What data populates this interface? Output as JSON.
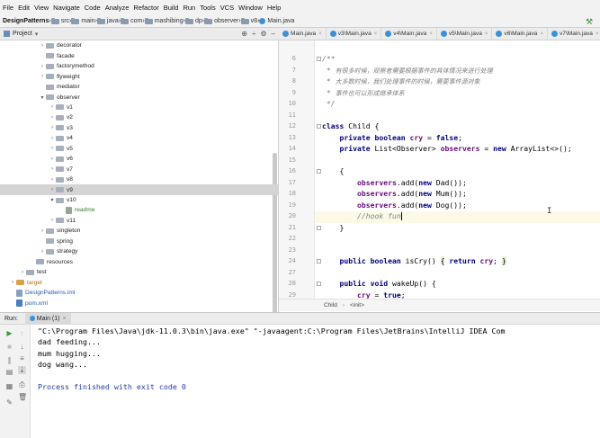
{
  "menu": [
    "File",
    "Edit",
    "View",
    "Navigate",
    "Code",
    "Analyze",
    "Refactor",
    "Build",
    "Run",
    "Tools",
    "VCS",
    "Window",
    "Help"
  ],
  "breadcrumb": [
    "DesignPatterns",
    "src",
    "main",
    "java",
    "com",
    "mashibing",
    "dp",
    "observer",
    "v8",
    "Main.java"
  ],
  "project": {
    "title": "Project",
    "tree": [
      {
        "label": "decorator",
        "depth": 3,
        "arrow": "right",
        "type": "pkg"
      },
      {
        "label": "facade",
        "depth": 3,
        "arrow": "",
        "type": "pkg"
      },
      {
        "label": "factorymethod",
        "depth": 3,
        "arrow": "right",
        "type": "pkg"
      },
      {
        "label": "flyweight",
        "depth": 3,
        "arrow": "right",
        "type": "pkg"
      },
      {
        "label": "mediator",
        "depth": 3,
        "arrow": "",
        "type": "pkg"
      },
      {
        "label": "observer",
        "depth": 3,
        "arrow": "down",
        "type": "pkg"
      },
      {
        "label": "v1",
        "depth": 4,
        "arrow": "right",
        "type": "pkg"
      },
      {
        "label": "v2",
        "depth": 4,
        "arrow": "right",
        "type": "pkg"
      },
      {
        "label": "v3",
        "depth": 4,
        "arrow": "right",
        "type": "pkg"
      },
      {
        "label": "v4",
        "depth": 4,
        "arrow": "right",
        "type": "pkg"
      },
      {
        "label": "v5",
        "depth": 4,
        "arrow": "right",
        "type": "pkg"
      },
      {
        "label": "v6",
        "depth": 4,
        "arrow": "right",
        "type": "pkg"
      },
      {
        "label": "v7",
        "depth": 4,
        "arrow": "right",
        "type": "pkg"
      },
      {
        "label": "v8",
        "depth": 4,
        "arrow": "right",
        "type": "pkg"
      },
      {
        "label": "v9",
        "depth": 4,
        "arrow": "right",
        "type": "pkg",
        "selected": true
      },
      {
        "label": "v10",
        "depth": 4,
        "arrow": "down",
        "type": "pkg"
      },
      {
        "label": "readme",
        "depth": 5,
        "arrow": "",
        "type": "file",
        "color": "green"
      },
      {
        "label": "v11",
        "depth": 4,
        "arrow": "right",
        "type": "pkg"
      },
      {
        "label": "singleton",
        "depth": 3,
        "arrow": "right",
        "type": "pkg"
      },
      {
        "label": "spring",
        "depth": 3,
        "arrow": "",
        "type": "pkg"
      },
      {
        "label": "strategy",
        "depth": 3,
        "arrow": "right",
        "type": "pkg"
      },
      {
        "label": "resources",
        "depth": 2,
        "arrow": "",
        "type": "folder"
      },
      {
        "label": "test",
        "depth": 1,
        "arrow": "right",
        "type": "folder"
      },
      {
        "label": "target",
        "depth": 0,
        "arrow": "right",
        "type": "orange",
        "color": "orange"
      },
      {
        "label": "DesignPatterns.iml",
        "depth": 0,
        "arrow": "",
        "type": "iml",
        "color": "blue"
      },
      {
        "label": "pom.xml",
        "depth": 0,
        "arrow": "",
        "type": "xml",
        "color": "blue"
      }
    ]
  },
  "tabs": [
    "Main.java",
    "v3\\Main.java",
    "v4\\Main.java",
    "v5\\Main.java",
    "v6\\Main.java",
    "v7\\Main.java"
  ],
  "editor": {
    "lines": [
      {
        "n": "6",
        "html": "<span class=\"cmt\">/**</span>"
      },
      {
        "n": "7",
        "html": "<span class=\"cmt\"> * </span><span class=\"cmt-cn\">有很多时候，观察者需要根据事件的具体情况来进行处理</span>"
      },
      {
        "n": "8",
        "html": "<span class=\"cmt\"> * </span><span class=\"cmt-cn\">大多数时候，我们处理事件的时候，需要事件源对象</span>"
      },
      {
        "n": "9",
        "html": "<span class=\"cmt\"> * </span><span class=\"cmt-cn\">事件也可以形成继承体系</span>"
      },
      {
        "n": "10",
        "html": "<span class=\"cmt\"> */</span>"
      },
      {
        "n": "11",
        "html": ""
      },
      {
        "n": "12",
        "html": "<span class=\"kw\">class</span> Child {"
      },
      {
        "n": "13",
        "html": "    <span class=\"kw\">private boolean</span> <span class=\"fld\">cry</span> = <span class=\"kw\">false</span>;"
      },
      {
        "n": "14",
        "html": "    <span class=\"kw\">private</span> List&lt;Observer&gt; <span class=\"fld\">observers</span> = <span class=\"kw\">new</span> ArrayList&lt;&gt;();"
      },
      {
        "n": "15",
        "html": ""
      },
      {
        "n": "16",
        "html": "    {"
      },
      {
        "n": "17",
        "html": "        <span class=\"fld\">observers</span>.add(<span class=\"kw\">new</span> Dad());"
      },
      {
        "n": "18",
        "html": "        <span class=\"fld\">observers</span>.add(<span class=\"kw\">new</span> Mum());"
      },
      {
        "n": "19",
        "html": "        <span class=\"fld\">observers</span>.add(<span class=\"kw\">new</span> Dog());"
      },
      {
        "n": "20",
        "html": "        <span class=\"cmt\">//hook fun</span><span class=\"caret\"></span>",
        "current": true
      },
      {
        "n": "21",
        "html": "    }"
      },
      {
        "n": "22",
        "html": ""
      },
      {
        "n": "23",
        "html": ""
      },
      {
        "n": "24",
        "html": "    <span class=\"kw\">public boolean</span> isCry() <span class=\"brace-hl\">{</span> <span class=\"kw\">return</span> <span class=\"fld\">cry</span>; <span class=\"brace-hl\">}</span>"
      },
      {
        "n": "27",
        "html": ""
      },
      {
        "n": "28",
        "html": "    <span class=\"kw\">public void</span> wakeUp() {"
      },
      {
        "n": "29",
        "html": "        <span class=\"fld\">cry</span> = <span class=\"kw\">true</span>;"
      }
    ],
    "breadcrumb": [
      "Child",
      "<init>"
    ]
  },
  "run": {
    "label": "Run:",
    "tab": "Main (1)",
    "console": [
      "\"C:\\Program Files\\Java\\jdk-11.0.3\\bin\\java.exe\" \"-javaagent:C:\\Program Files\\JetBrains\\IntelliJ IDEA Com",
      "dad feeding...",
      "mum hugging...",
      "dog wang...",
      "",
      "Process finished with exit code 0"
    ]
  }
}
